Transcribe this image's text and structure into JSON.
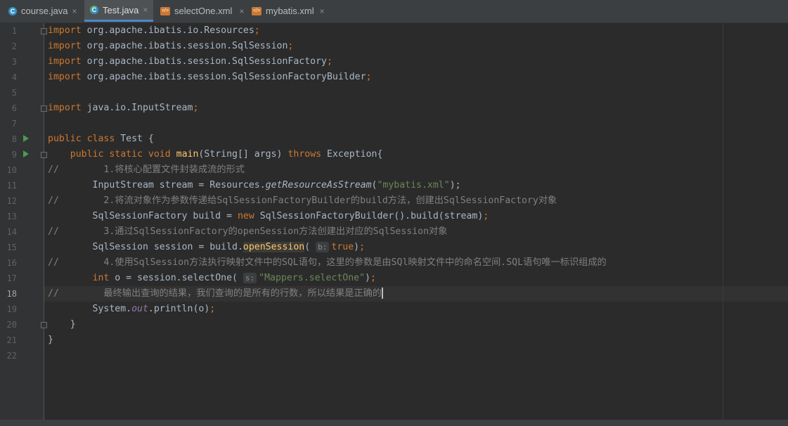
{
  "tabs": [
    {
      "label": "course.java",
      "icon": "java-class-icon",
      "icon_letter": "C"
    },
    {
      "label": "Test.java",
      "icon": "java-class-icon",
      "icon_letter": "C",
      "active": true
    },
    {
      "label": "selectOne.xml",
      "icon": "xml-file-icon",
      "icon_letter": "</>"
    },
    {
      "label": "mybatis.xml",
      "icon": "xml-file-icon",
      "icon_letter": "</>"
    }
  ],
  "close_glyph": "×",
  "current_line": 18,
  "line_numbers": [
    "1",
    "2",
    "3",
    "4",
    "5",
    "6",
    "7",
    "8",
    "9",
    "10",
    "11",
    "12",
    "13",
    "14",
    "15",
    "16",
    "17",
    "18",
    "19",
    "20",
    "21",
    "22"
  ],
  "code": {
    "l1": [
      "import",
      " org.apache.ibatis.io.Resources",
      ";"
    ],
    "l2": [
      "import",
      " org.apache.ibatis.session.SqlSession",
      ";"
    ],
    "l3": [
      "import",
      " org.apache.ibatis.session.SqlSessionFactory",
      ";"
    ],
    "l4": [
      "import",
      " org.apache.ibatis.session.SqlSessionFactoryBuilder",
      ";"
    ],
    "l6": [
      "import",
      " java.io.InputStream",
      ";"
    ],
    "l8": [
      "public class",
      " Test {"
    ],
    "l9": [
      "    ",
      "public static void",
      " ",
      "main",
      "(String[] args) ",
      "throws",
      " Exception{"
    ],
    "l10": [
      "//        1.将核心配置文件封装成流的形式"
    ],
    "l11": [
      "        InputStream stream = Resources.",
      "getResourceAsStream",
      "(",
      "\"mybatis.xml\"",
      ");"
    ],
    "l12": [
      "//        2.将流对象作为参数传递给SqlSessionFactoryBuilder的build方法，创建出SqlSessionFactory对象"
    ],
    "l13": [
      "        SqlSessionFactory build = ",
      "new",
      " SqlSessionFactoryBuilder().build(stream)",
      ";"
    ],
    "l14": [
      "//        3.通过SqlSessionFactory的openSession方法创建出对应的SqlSession对象"
    ],
    "l15": [
      "        SqlSession session = build.",
      "openSession",
      "( ",
      "b:",
      "true",
      ")",
      ";"
    ],
    "l16": [
      "//        4.使用SqlSession方法执行映射文件中的SQL语句，这里的参数是由SQl映射文件中的命名空间.SQL语句唯一标识组成的"
    ],
    "l17": [
      "        ",
      "int",
      " o = session.selectOne( ",
      "s:",
      "\"Mappers.selectOne\"",
      ")",
      ";"
    ],
    "l18": [
      "//        最终输出查询的结果，我们查询的是所有的行数，所以结果是正确的"
    ],
    "l19": [
      "        System.",
      "out",
      ".println(o)",
      ";"
    ],
    "l20": [
      "    }"
    ],
    "l21": [
      "}"
    ]
  }
}
